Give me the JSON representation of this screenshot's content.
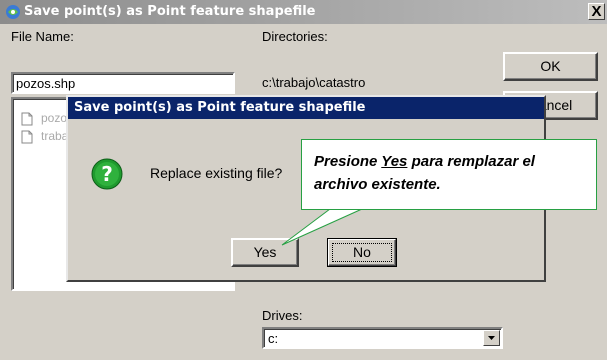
{
  "main_window": {
    "title": "Save point(s) as Point feature shapefile",
    "close_glyph": "X",
    "file_name_label": "File Name:",
    "file_name_value": "pozos.shp",
    "file_list_items": [
      "pozos",
      "trabajo"
    ],
    "directories_label": "Directories:",
    "directory_path": "c:\\trabajo\\catastro",
    "ok_label": "OK",
    "cancel_label": "Cancel",
    "drives_label": "Drives:",
    "drive_value": "c:"
  },
  "confirm_dialog": {
    "title": "Save point(s) as Point feature shapefile",
    "message": "Replace existing file?",
    "yes_label": "Yes",
    "no_label": "No",
    "icon": "question-icon"
  },
  "callout": {
    "prefix": "Presione ",
    "emphasis": "Yes",
    "suffix": " para remplazar el archivo existente."
  },
  "colors": {
    "dialog_titlebar": "#0a246a",
    "main_titlebar_inactive": "#8c8c8c",
    "callout_border": "#27a043",
    "question_icon": "#1f9a2e"
  }
}
